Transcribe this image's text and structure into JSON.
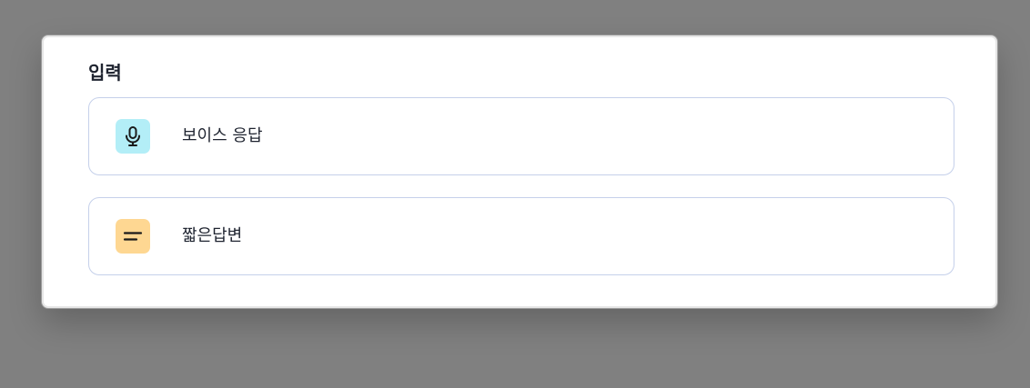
{
  "section": {
    "title": "입력"
  },
  "options": [
    {
      "label": "보이스 응답",
      "icon": "microphone-icon",
      "icon_color": "#b3eef7"
    },
    {
      "label": "짧은답변",
      "icon": "short-text-icon",
      "icon_color": "#fed792"
    }
  ],
  "colors": {
    "backdrop": "#808080",
    "panel": "#ffffff",
    "option_border": "#c5d0ea",
    "text": "#1f2430"
  }
}
